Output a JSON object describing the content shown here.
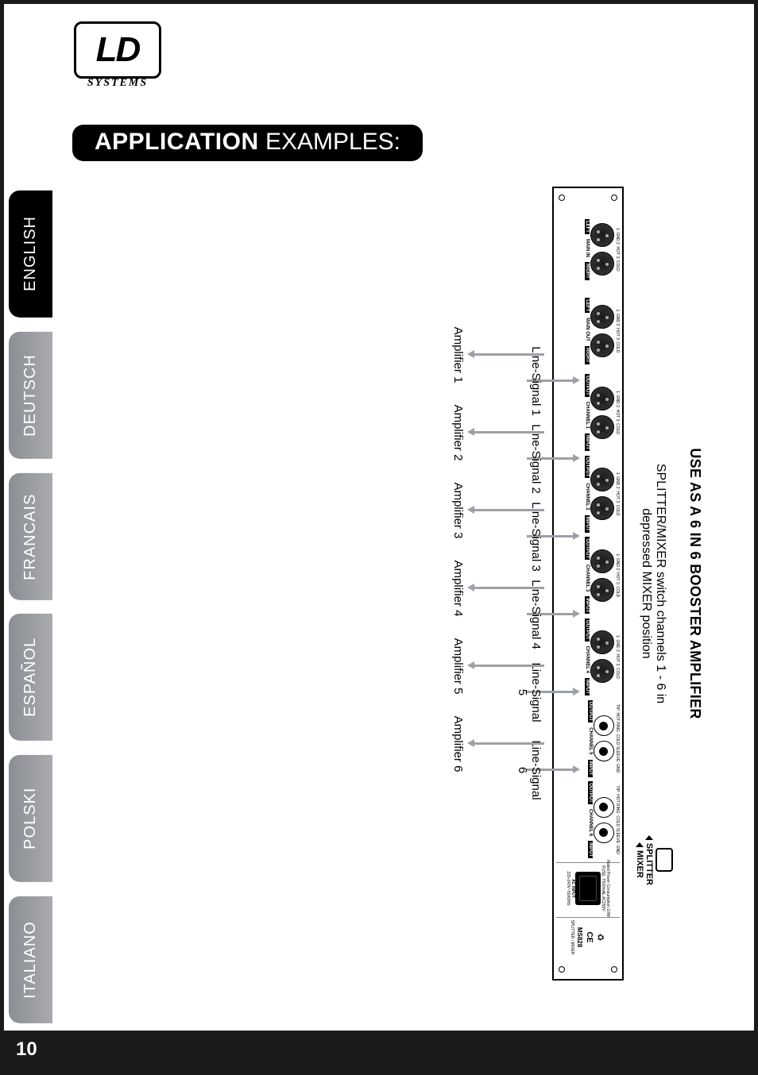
{
  "logo": {
    "main": "LD",
    "sub": "SYSTEMS"
  },
  "heading": {
    "bold": "APPLICATION",
    "normal": " EXAMPLES:"
  },
  "languages": [
    "ENGLISH",
    "DEUTSCH",
    "FRANCAIS",
    "ESPAÑOL",
    "POLSKI",
    "ITALIANO"
  ],
  "active_language_index": 0,
  "page_number": "10",
  "section": {
    "title": "USE AS A 6 IN 6 BOOSTER AMPLIFIER",
    "desc_line1": "SPLITTER/MIXER switch channels 1 - 6  in",
    "desc_line2": "depressed MIXER position",
    "switch": {
      "top": "SPLITTER",
      "bottom": "MIXER"
    }
  },
  "rack": {
    "model": "MS828",
    "model_sub": "SPLITTER / MIXER",
    "main_in": {
      "label": "MAIN IN",
      "left": "LEFT",
      "right": "RIGHT",
      "pins": "1: GND   2: HOT   3: COLD"
    },
    "main_out": {
      "label": "MAIN OUT",
      "left": "LEFT",
      "right": "RIGHT",
      "pins": "1: GND   2: HOT   3: COLD"
    },
    "channel_label_prefix": "CHANNEL",
    "in_label": "INPUT",
    "out_label": "OUTPUT",
    "trs_pins": "TIP: HOT  RING: COLD  SLEEVE: GND",
    "xlr_pins": "1: GND   2: HOT   3: COLD",
    "power": {
      "ac": "AC INPUT",
      "volts": "220-240V~50/60Hz",
      "fuse": "FUSE: T500mAL AC250V",
      "cons": "Rated Power Consumption 10W"
    }
  },
  "signals": [
    {
      "idx": "1",
      "label": "Line-Signal 1"
    },
    {
      "idx": "2",
      "label": "Line-Signal 2"
    },
    {
      "idx": "3",
      "label": "Line-Signal 3"
    },
    {
      "idx": "4",
      "label": "Line-Signal 4"
    },
    {
      "idx": "5",
      "label": "Line-Signal"
    },
    {
      "idx": "6",
      "label": "Line-Signal"
    }
  ],
  "amplifiers": [
    "Amplifier 1",
    "Amplifier 2",
    "Amplifier 3",
    "Amplifier 4",
    "Amplifier 5",
    "Amplifier 6"
  ]
}
